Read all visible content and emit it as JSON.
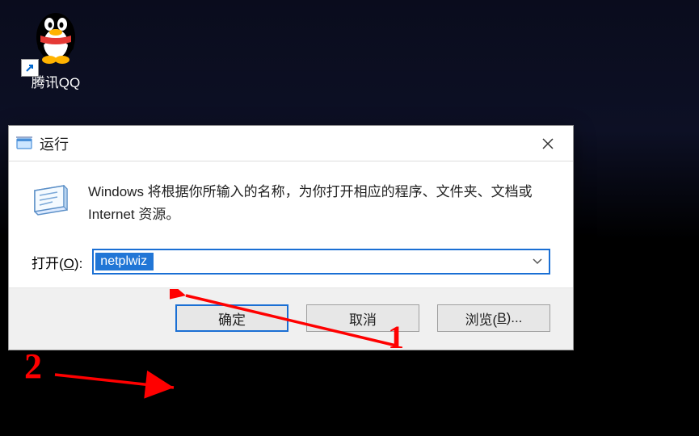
{
  "desktop": {
    "qq_label": "腾讯QQ"
  },
  "dialog": {
    "title": "运行",
    "message": "Windows 将根据你所输入的名称，为你打开相应的程序、文件夹、文档或 Internet 资源。",
    "open_label_pre": "打开(",
    "open_label_u": "O",
    "open_label_post": "):",
    "input_value": "netplwiz",
    "ok": "确定",
    "cancel": "取消",
    "browse_pre": "浏览(",
    "browse_u": "B",
    "browse_post": ")..."
  },
  "annotations": {
    "num1": "1",
    "num2": "2"
  }
}
